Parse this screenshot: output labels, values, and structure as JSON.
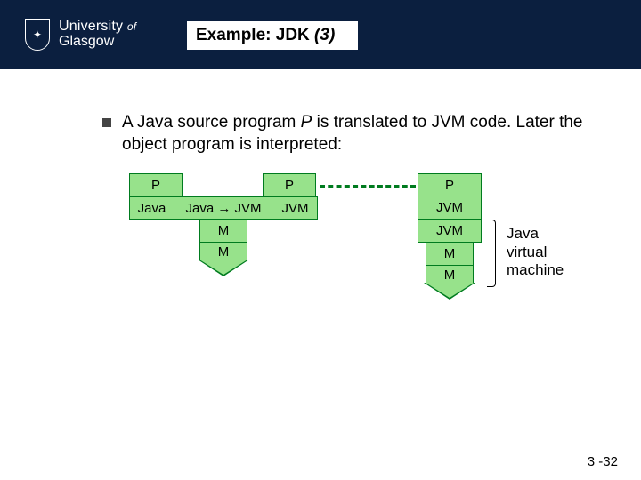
{
  "header": {
    "logo_line1a": "University",
    "logo_line1_small": "of",
    "logo_line2": "Glasgow",
    "title_prefix": "Example: JDK ",
    "title_italic": "(3)"
  },
  "bullet": {
    "t1": "A Java source program ",
    "p": "P",
    "t2": " is translated to JVM code. Later the object program is interpreted:"
  },
  "diagram": {
    "left": {
      "head_left": "P",
      "head_right": "P",
      "mid_left": "Java",
      "mid_mid": "Java → JVM",
      "mid_right": "JVM",
      "leg1": "M",
      "leg2": "M"
    },
    "right": {
      "head": "P",
      "r1": "JVM",
      "r2": "JVM",
      "r3": "M",
      "r4": "M"
    },
    "annotation": "Java\nvirtual\nmachine"
  },
  "pagenum": "3 -32"
}
